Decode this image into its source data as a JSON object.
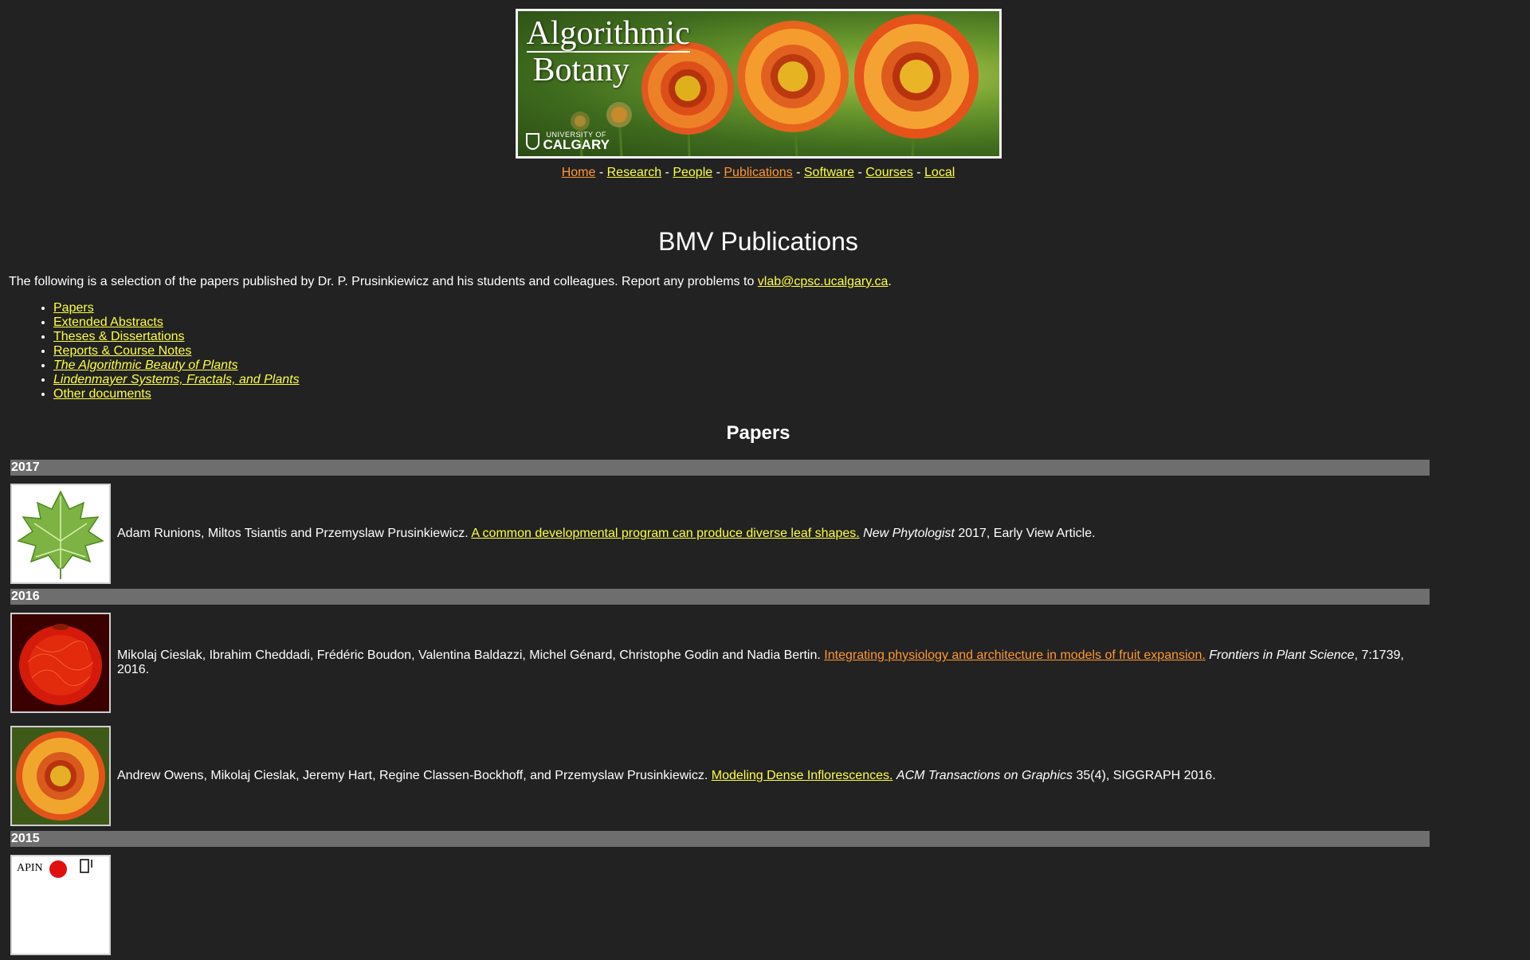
{
  "banner": {
    "title_line1": "Algorithmic",
    "title_line2": "Botany",
    "university_small": "UNIVERSITY OF",
    "university_big": "CALGARY"
  },
  "nav": {
    "items": [
      {
        "label": "Home",
        "visited": true
      },
      {
        "label": "Research",
        "visited": false
      },
      {
        "label": "People",
        "visited": false
      },
      {
        "label": "Publications",
        "visited": true
      },
      {
        "label": "Software",
        "visited": false
      },
      {
        "label": "Courses",
        "visited": false
      },
      {
        "label": "Local",
        "visited": false
      }
    ],
    "separator": " - "
  },
  "page": {
    "title": "BMV Publications",
    "intro_text": "The following is a selection of the papers published by Dr. P. Prusinkiewicz and his students and colleagues. Report any problems to ",
    "intro_email": "vlab@cpsc.ucalgary.ca",
    "intro_end": "."
  },
  "toc": [
    {
      "label": "Papers",
      "italic": false
    },
    {
      "label": "Extended Abstracts",
      "italic": false
    },
    {
      "label": "Theses & Dissertations",
      "italic": false
    },
    {
      "label": "Reports & Course Notes",
      "italic": false
    },
    {
      "label": "The Algorithmic Beauty of Plants",
      "italic": true
    },
    {
      "label": "Lindenmayer Systems, Fractals, and Plants",
      "italic": true
    },
    {
      "label": "Other documents",
      "italic": false
    }
  ],
  "papers_heading": "Papers",
  "years": [
    {
      "year": "2017",
      "entries": [
        {
          "thumb": "leaf-thumbnail",
          "authors": "Adam Runions, Miltos Tsiantis and Przemyslaw Prusinkiewicz. ",
          "title": "A common developmental program can produce diverse leaf shapes.",
          "visited": false,
          "journal": "New Phytologist",
          "rest": " 2017, Early View Article."
        }
      ]
    },
    {
      "year": "2016",
      "entries": [
        {
          "thumb": "fruit-thumbnail",
          "authors": "Mikolaj Cieslak, Ibrahim Cheddadi, Frédéric Boudon, Valentina Baldazzi, Michel Génard, Christophe Godin and Nadia Bertin. ",
          "title": "Integrating physiology and architecture in models of fruit expansion.",
          "visited": true,
          "journal": "Frontiers in Plant Science",
          "rest": ", 7:1739, 2016."
        },
        {
          "thumb": "flower-thumbnail",
          "authors": "Andrew Owens, Mikolaj Cieslak, Jeremy Hart, Regine Classen-Bockhoff, and Przemyslaw Prusinkiewicz. ",
          "title": "Modeling Dense Inflorescences.",
          "visited": false,
          "journal": "ACM Transactions on Graphics",
          "rest": " 35(4), SIGGRAPH 2016."
        }
      ]
    },
    {
      "year": "2015",
      "entries": [
        {
          "thumb": "apin-diagram-thumbnail",
          "thumb_text": "APIN",
          "authors": "",
          "title": "",
          "visited": false,
          "journal": "",
          "rest": ""
        }
      ]
    }
  ],
  "colors": {
    "background": "#222222",
    "link": "#ffff44",
    "visited_link": "#ff9933",
    "year_bar": "#6e6e6e"
  }
}
